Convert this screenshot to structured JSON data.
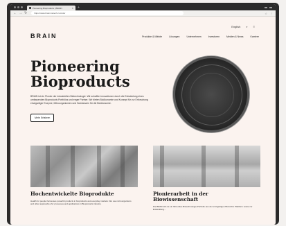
{
  "browser": {
    "tab_title": "Pioneering Bioproducts | BRAIN",
    "new_tab_symbol": "+",
    "close_symbol": "×",
    "url": "https://www.brain-biotech.com/de/",
    "back_symbol": "←",
    "forward_symbol": "→",
    "reload_symbol": "↻",
    "toolbar_icons": [
      "☆",
      "⋮"
    ]
  },
  "site": {
    "logo": "BRAIN",
    "utility": {
      "language": "English",
      "search_symbol": "⌕",
      "menu_symbol": "≡"
    },
    "nav": [
      "Produkte & Märkte",
      "Lösungen",
      "Unternehmen",
      "Investoren",
      "Medien & News",
      "Karriere"
    ]
  },
  "hero": {
    "title_line1": "Pioneering",
    "title_line2": "Bioproducts",
    "body": "BRAIN ist ein Pionier der industriellen Biotechnologie. Wir schaffen innovationen durch die Entwicklung eines umfassenden Bioproducts Portfolios und enger Partner. Wir bieten Bioökonomie und Konzept für zur Erforschung einzigartiger Enzyme, Mikroorganismen und Substanzen für die Bioökonomie.",
    "cta_label": "Mehr Erfahren"
  },
  "cards": [
    {
      "title": "Hochentwickelte Bioprodukte",
      "text": "Health for people harnesses powerful products in bioproducts and everyday markets. We use microorganisms and other approaches for processes and applications in Bioproducts industry."
    },
    {
      "title_line1": "Pionierarbeit in der",
      "title_line2": "Biowissenschaft",
      "text": "Die BRAIN AG ist ein führendes Biotechnologie-Portfolio aus der einzigartigen BioArchiv Plattform sowie zur Entwicklung..."
    }
  ],
  "colors": {
    "page_bg": "#fbf3ef",
    "chrome_dark": "#2b2b2b",
    "text_dark": "#1a1a1a"
  }
}
